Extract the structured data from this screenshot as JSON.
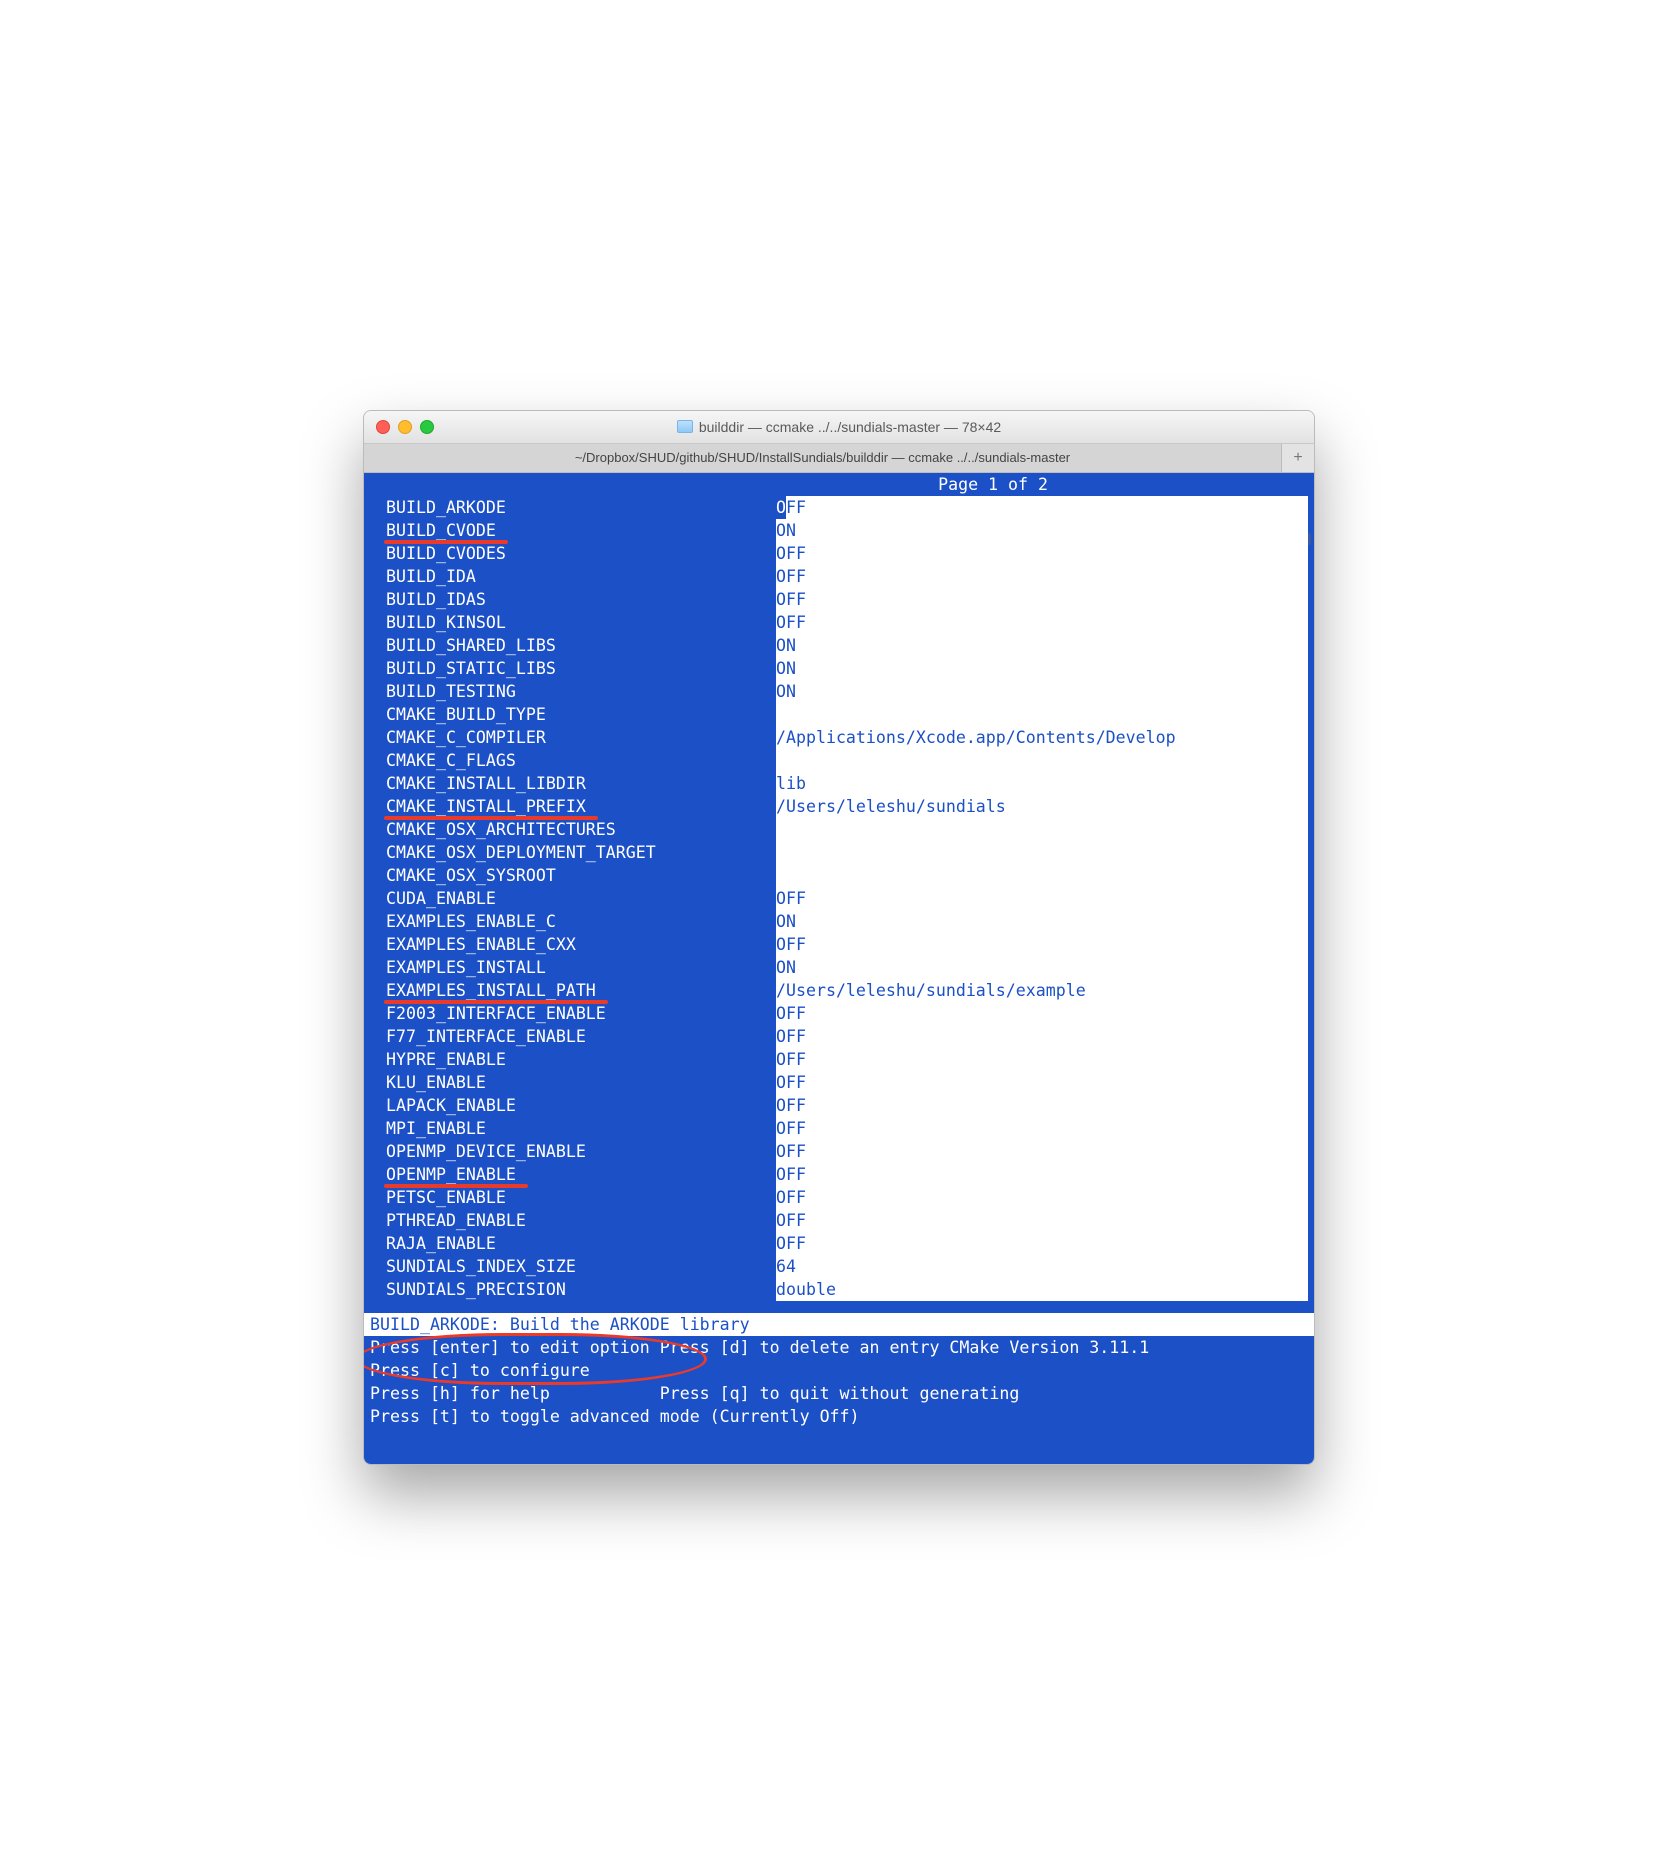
{
  "window": {
    "title": "builddir — ccmake ../../sundials-master — 78×42",
    "tab": "~/Dropbox/SHUD/github/SHUD/InstallSundials/builddir — ccmake ../../sundials-master",
    "add_tab": "+"
  },
  "page_info": "Page 1 of 2",
  "options": [
    {
      "key": "BUILD_ARKODE",
      "value": "OFF",
      "selected": true
    },
    {
      "key": "BUILD_CVODE",
      "value": "ON",
      "underline": true
    },
    {
      "key": "BUILD_CVODES",
      "value": "OFF"
    },
    {
      "key": "BUILD_IDA",
      "value": "OFF"
    },
    {
      "key": "BUILD_IDAS",
      "value": "OFF"
    },
    {
      "key": "BUILD_KINSOL",
      "value": "OFF"
    },
    {
      "key": "BUILD_SHARED_LIBS",
      "value": "ON"
    },
    {
      "key": "BUILD_STATIC_LIBS",
      "value": "ON"
    },
    {
      "key": "BUILD_TESTING",
      "value": "ON"
    },
    {
      "key": "CMAKE_BUILD_TYPE",
      "value": ""
    },
    {
      "key": "CMAKE_C_COMPILER",
      "value": "/Applications/Xcode.app/Contents/Develop"
    },
    {
      "key": "CMAKE_C_FLAGS",
      "value": ""
    },
    {
      "key": "CMAKE_INSTALL_LIBDIR",
      "value": "lib"
    },
    {
      "key": "CMAKE_INSTALL_PREFIX",
      "value": "/Users/leleshu/sundials",
      "underline": true
    },
    {
      "key": "CMAKE_OSX_ARCHITECTURES",
      "value": ""
    },
    {
      "key": "CMAKE_OSX_DEPLOYMENT_TARGET",
      "value": ""
    },
    {
      "key": "CMAKE_OSX_SYSROOT",
      "value": ""
    },
    {
      "key": "CUDA_ENABLE",
      "value": "OFF"
    },
    {
      "key": "EXAMPLES_ENABLE_C",
      "value": "ON"
    },
    {
      "key": "EXAMPLES_ENABLE_CXX",
      "value": "OFF"
    },
    {
      "key": "EXAMPLES_INSTALL",
      "value": "ON"
    },
    {
      "key": "EXAMPLES_INSTALL_PATH",
      "value": "/Users/leleshu/sundials/example",
      "underline": true
    },
    {
      "key": "F2003_INTERFACE_ENABLE",
      "value": "OFF"
    },
    {
      "key": "F77_INTERFACE_ENABLE",
      "value": "OFF"
    },
    {
      "key": "HYPRE_ENABLE",
      "value": "OFF"
    },
    {
      "key": "KLU_ENABLE",
      "value": "OFF"
    },
    {
      "key": "LAPACK_ENABLE",
      "value": "OFF"
    },
    {
      "key": "MPI_ENABLE",
      "value": "OFF"
    },
    {
      "key": "OPENMP_DEVICE_ENABLE",
      "value": "OFF"
    },
    {
      "key": "OPENMP_ENABLE",
      "value": "OFF",
      "underline": true
    },
    {
      "key": "PETSC_ENABLE",
      "value": "OFF"
    },
    {
      "key": "PTHREAD_ENABLE",
      "value": "OFF"
    },
    {
      "key": "RAJA_ENABLE",
      "value": "OFF"
    },
    {
      "key": "SUNDIALS_INDEX_SIZE",
      "value": "64"
    },
    {
      "key": "SUNDIALS_PRECISION",
      "value": "double"
    }
  ],
  "status": {
    "selected": "BUILD_ARKODE: Build the ARKODE library",
    "hint_edit": "Press [enter] to edit option Press [d] to delete an entry CMake Version 3.11.1",
    "hint_conf": "Press [c] to configure",
    "hint_help": "Press [h] for help           Press [q] to quit without generating",
    "hint_adv": "Press [t] to toggle advanced mode (Currently Off)"
  }
}
